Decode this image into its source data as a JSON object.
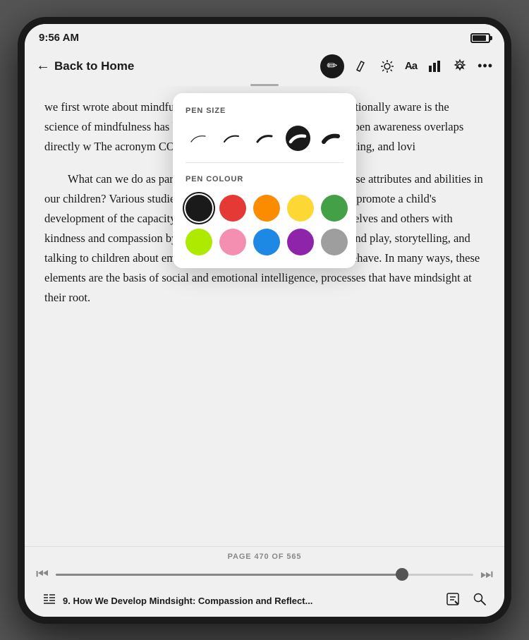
{
  "status": {
    "time": "9:56 AM"
  },
  "nav": {
    "back_label": "Back to Home",
    "icons": {
      "pen": "✒",
      "eraser": "◇",
      "brightness": "☀",
      "font": "Aa",
      "chart": "▐▌",
      "settings": "⚙",
      "more": "•••"
    }
  },
  "popup": {
    "pen_size_label": "PEN SIZE",
    "pen_colour_label": "PEN COLOUR",
    "sizes": [
      "xs",
      "sm",
      "md",
      "md-bold",
      "lg"
    ],
    "selected_size_index": 3,
    "colors": [
      {
        "name": "black",
        "hex": "#1a1a1a",
        "selected": true
      },
      {
        "name": "red",
        "hex": "#e53935"
      },
      {
        "name": "orange",
        "hex": "#fb8c00"
      },
      {
        "name": "yellow",
        "hex": "#fdd835"
      },
      {
        "name": "green",
        "hex": "#43a047"
      },
      {
        "name": "lime",
        "hex": "#aeea00"
      },
      {
        "name": "pink",
        "hex": "#f48fb1"
      },
      {
        "name": "blue",
        "hex": "#1e88e5"
      },
      {
        "name": "purple",
        "hex": "#8e24aa"
      },
      {
        "name": "gray",
        "hex": "#9e9e9e"
      }
    ]
  },
  "content": {
    "para1": "we first wrote about mindfulness, the general notion of being intentionally aware is the science of mindfulness has blossomed, and we that presence and open awareness overlaps directly w The acronym COAL is a helpful w curious, open, accepting, and lovi",
    "para2": "What can we do as parents to promote the development of these attributes and abilities in our children? Various studies have shown that parents can actively promote a child's development of the capacity to understand the inner lives of themselves and others with kindness and compassion by engaging in interactions such as pretend play, storytelling, and talking to children about emotions and their impact on how they behave. In many ways, these elements are the basis of social and emotional intelligence, processes that have mindsight at their root."
  },
  "footer": {
    "page_label": "PAGE 470 OF 565",
    "chapter_title": "9. How We Develop Mindsight: Compassion and Reflect...",
    "progress_pct": 83
  }
}
